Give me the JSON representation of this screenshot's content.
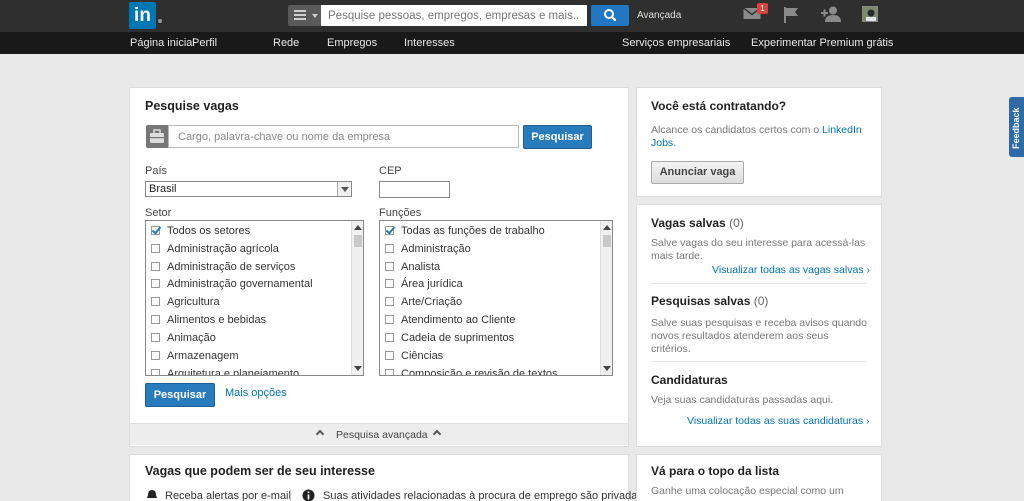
{
  "header": {
    "logo_text": "in",
    "search_placeholder": "Pesquise pessoas, empregos, empresas e mais...",
    "advanced_link": "Avançada",
    "message_count": "1"
  },
  "nav": {
    "items": [
      "Página inicial",
      "Perfil",
      "Rede",
      "Empregos",
      "Interesses"
    ],
    "right_items": [
      "Serviços empresariais",
      "Experimentar Premium grátis"
    ]
  },
  "search_jobs": {
    "title": "Pesquise vagas",
    "keyword_placeholder": "Cargo, palavra-chave ou nome da empresa",
    "search_button": "Pesquisar",
    "country_label": "País",
    "country_value": "Brasil",
    "zip_label": "CEP",
    "sector_label": "Setor",
    "sectors": [
      {
        "label": "Todos os setores",
        "checked": true
      },
      {
        "label": "Administração agrícola",
        "checked": false
      },
      {
        "label": "Administração de serviços",
        "checked": false
      },
      {
        "label": "Administração governamental",
        "checked": false
      },
      {
        "label": "Agricultura",
        "checked": false
      },
      {
        "label": "Alimentos e bebidas",
        "checked": false
      },
      {
        "label": "Animação",
        "checked": false
      },
      {
        "label": "Armazenagem",
        "checked": false
      },
      {
        "label": "Arquitetura e planejamento",
        "checked": false
      }
    ],
    "functions_label": "Funções",
    "functions": [
      {
        "label": "Todas as funções de trabalho",
        "checked": true
      },
      {
        "label": "Administração",
        "checked": false
      },
      {
        "label": "Analista",
        "checked": false
      },
      {
        "label": "Área jurídica",
        "checked": false
      },
      {
        "label": "Arte/Criação",
        "checked": false
      },
      {
        "label": "Atendimento ao Cliente",
        "checked": false
      },
      {
        "label": "Cadeia de suprimentos",
        "checked": false
      },
      {
        "label": "Ciências",
        "checked": false
      },
      {
        "label": "Composição e revisão de textos",
        "checked": false
      }
    ],
    "bottom_search_button": "Pesquisar",
    "more_options": "Mais opções",
    "advanced_search": "Pesquisa avançada"
  },
  "suggested_jobs": {
    "title": "Vagas que podem ser de seu interesse",
    "alerts_text": "Receba alertas por e-mail",
    "privacy_text": "Suas atividades relacionadas à procura de emprego são privadas"
  },
  "hiring": {
    "title": "Você está contratando?",
    "text": "Alcance os candidatos certos com o ",
    "link": "LinkedIn Jobs",
    "text_end": ".",
    "button": "Anunciar vaga"
  },
  "saved_jobs": {
    "title": "Vagas salvas",
    "count": "(0)",
    "text": "Salve vagas do seu interesse para acessá-las mais tarde.",
    "link": "Visualizar todas as vagas salvas"
  },
  "saved_searches": {
    "title": "Pesquisas salvas",
    "count": "(0)",
    "text": "Salve suas pesquisas e receba avisos quando novos resultados atenderem aos seus critérios."
  },
  "applications": {
    "title": "Candidaturas",
    "text": "Veja suas candidaturas passadas aqui.",
    "link": "Visualizar todas as suas candidaturas"
  },
  "top_of_list": {
    "title": "Vá para o topo da lista",
    "text": "Ganhe uma colocação especial como um"
  },
  "feedback_tab": "Feedback"
}
